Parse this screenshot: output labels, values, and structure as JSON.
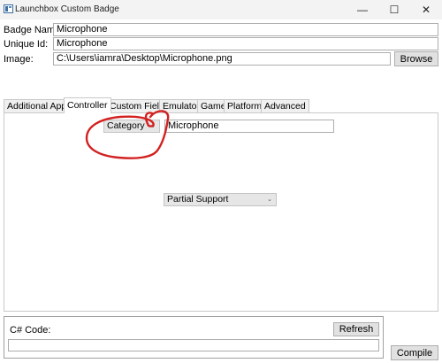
{
  "window": {
    "title": "Launchbox Custom Badge",
    "minimize_glyph": "—",
    "maximize_glyph": "☐",
    "close_glyph": "✕"
  },
  "form": {
    "badge_name_label": "Badge Name:",
    "badge_name_value": "Microphone",
    "unique_id_label": "Unique Id:",
    "unique_id_value": "Microphone",
    "image_label": "Image:",
    "image_value": "C:\\Users\\iamra\\Desktop\\Microphone.png",
    "browse_label": "Browse"
  },
  "tabs": [
    {
      "label": "Additional App"
    },
    {
      "label": "Controller"
    },
    {
      "label": "Custom Field"
    },
    {
      "label": "Emulator"
    },
    {
      "label": "Game"
    },
    {
      "label": "Platform"
    },
    {
      "label": "Advanced"
    }
  ],
  "active_tab": "Controller",
  "controller": {
    "category_value": "Category",
    "category_text": "Microphone",
    "support_value": "Partial Support"
  },
  "code": {
    "label": "C# Code:",
    "value": "",
    "refresh_label": "Refresh",
    "compile_label": "Compile"
  },
  "annotation": {
    "stroke_color": "#d32020"
  }
}
